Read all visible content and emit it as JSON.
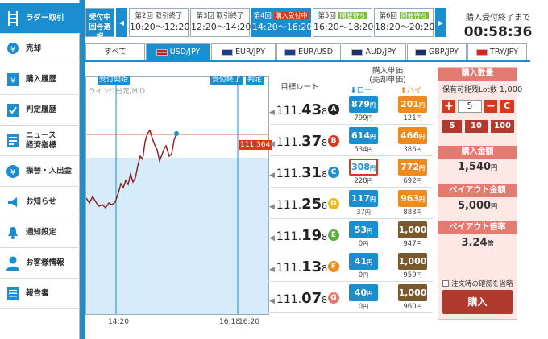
{
  "sidebar": {
    "items": [
      {
        "label": "ラダー取引",
        "icon": "ladder-icon"
      },
      {
        "label": "売却",
        "icon": "sell-icon"
      },
      {
        "label": "購入履歴",
        "icon": "purchase-history-icon"
      },
      {
        "label": "判定履歴",
        "icon": "judgement-history-icon"
      },
      {
        "label1": "ニュース",
        "label2": "経済指標",
        "icon": "news-icon"
      },
      {
        "label": "振替・入出金",
        "icon": "yen-icon"
      },
      {
        "label": "お知らせ",
        "icon": "megaphone-icon"
      },
      {
        "label": "通知設定",
        "icon": "bell-icon"
      },
      {
        "label": "お客様情報",
        "icon": "user-icon"
      },
      {
        "label": "報告書",
        "icon": "report-icon"
      }
    ]
  },
  "sessions": {
    "first_line1": "受付中",
    "first_line2": "回号選択",
    "items": [
      {
        "title": "第2回 取引終了",
        "time": "10:20〜12:20"
      },
      {
        "title": "第3回 取引終了",
        "time": "12:20〜14:20"
      },
      {
        "title_prefix": "第4回",
        "badge": "購入受付中",
        "time": "14:20〜16:20"
      },
      {
        "title_prefix": "第5回",
        "badge": "開催待ち",
        "time": "16:20〜18:20"
      },
      {
        "title_prefix": "第6回",
        "badge": "開催待ち",
        "time": "18:20〜20:20"
      }
    ],
    "prev_icon": "prev-arrow-icon",
    "next_icon": "next-arrow-icon"
  },
  "countdown": {
    "label": "購入受付終了まで",
    "value": "00:58:36"
  },
  "tabs": [
    "すべて",
    "USD/JPY",
    "EUR/JPY",
    "EUR/USD",
    "AUD/JPY",
    "GBP/JPY",
    "TRY/JPY"
  ],
  "chart": {
    "label_start": "受付開始",
    "label_end": "受付終了",
    "label_judge": "判定",
    "mid_label": "ライン/1分足/MID",
    "current_price": "111.364",
    "x_labels": [
      "14:20",
      "16:18",
      "16:20"
    ]
  },
  "ladder": {
    "header_target": "目標レート",
    "header_price1": "購入単価",
    "header_price2": "(売却単価)",
    "header_low": "ロー",
    "header_high": "ハイ",
    "yen": "円",
    "rows": [
      {
        "main": "111.",
        "big": "43",
        "last": "8",
        "letter": "A",
        "color": "#222222",
        "low": "879",
        "low_sub": "799",
        "high": "201",
        "high_sub": "121",
        "high_full": false,
        "low_selected": false
      },
      {
        "main": "111.",
        "big": "37",
        "last": "8",
        "letter": "B",
        "color": "#d9381e",
        "low": "614",
        "low_sub": "534",
        "high": "466",
        "high_sub": "386",
        "high_full": false,
        "low_selected": false
      },
      {
        "main": "111.",
        "big": "31",
        "last": "8",
        "letter": "C",
        "color": "#1b8ed0",
        "low": "308",
        "low_sub": "228",
        "high": "772",
        "high_sub": "692",
        "high_full": false,
        "low_selected": true
      },
      {
        "main": "111.",
        "big": "25",
        "last": "8",
        "letter": "D",
        "color": "#f0b81c",
        "low": "117",
        "low_sub": "37",
        "high": "963",
        "high_sub": "883",
        "high_full": false,
        "low_selected": false
      },
      {
        "main": "111.",
        "big": "19",
        "last": "8",
        "letter": "E",
        "color": "#5aaf3c",
        "low": "53",
        "low_sub": "0",
        "high": "1,000",
        "high_sub": "947",
        "high_full": true,
        "low_selected": false
      },
      {
        "main": "111.",
        "big": "13",
        "last": "8",
        "letter": "F",
        "color": "#f08a1c",
        "low": "41",
        "low_sub": "0",
        "high": "1,000",
        "high_sub": "959",
        "high_full": true,
        "low_selected": false
      },
      {
        "main": "111.",
        "big": "07",
        "last": "8",
        "letter": "G",
        "color": "#e57a70",
        "low": "40",
        "low_sub": "0",
        "high": "1,000",
        "high_sub": "960",
        "high_full": true,
        "low_selected": false
      }
    ]
  },
  "panel": {
    "qty_title": "購入数量",
    "lot_label": "保有可能残Lot数",
    "lot_value": "1,000",
    "plus": "+",
    "qty_value": "5",
    "minus": "−",
    "clear": "C",
    "presets": [
      "5",
      "10",
      "100"
    ],
    "amount_title": "購入金額",
    "amount_value": "1,540",
    "payout_title": "ペイアウト金額",
    "payout_value": "5,000",
    "ratio_title": "ペイアウト倍率",
    "ratio_value": "3.24",
    "ratio_unit": "倍",
    "confirm_label": "注文時の確認を省略",
    "buy_label": "購入",
    "yen": "円"
  },
  "colors": {
    "accent": "#1b8ed0",
    "high": "#f08a1c",
    "high_full": "#7a5a2c",
    "panel": "#e57a70",
    "buy": "#c0392b"
  }
}
